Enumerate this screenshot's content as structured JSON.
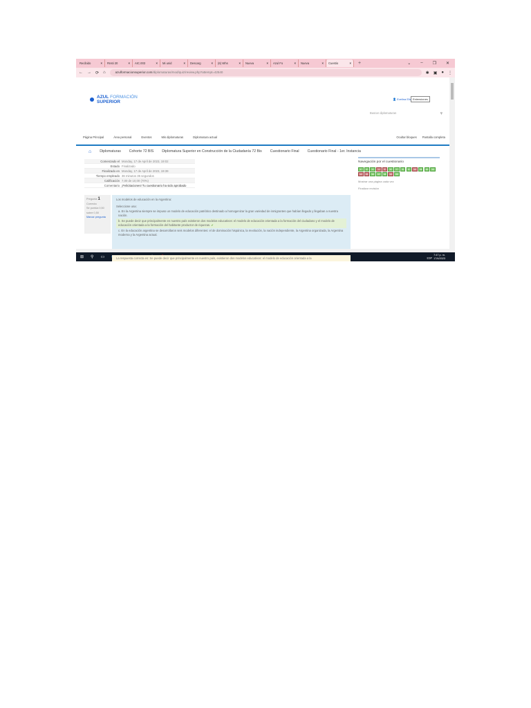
{
  "browser": {
    "tabs": [
      "Recibido",
      "Rnsti 20",
      "AIC.003",
      "Mi unid",
      "Descarg",
      "(6) Whs",
      "Nueva",
      "Azul Fo",
      "Nueva",
      "Cuestio"
    ],
    "url_domain": "azulformacionsuperior.com",
    "url_path": "/diplomaturas/mod/quiz/review.php?attempt=42540",
    "tooltip": "Extensiones"
  },
  "site": {
    "logo_line1": "AZUL",
    "logo_line1b": " FORMACIÓN",
    "logo_line2": "SUPERIOR",
    "search_placeholder": "Buscar diplomaturas",
    "user": "Evelina Elizabeth Lo",
    "menu": [
      "Página Principal",
      "Área personal",
      "Eventos",
      "Mis diplomaturas",
      "Diplomatura actual"
    ],
    "menu_right": [
      "Ocultar bloques",
      "Pantalla completa"
    ]
  },
  "breadcrumb": [
    "Diplomaturas",
    "Cohorte 72 BIS",
    "Diplomatura Superior en Construcción de la Ciudadanía 72 Bis",
    "Cuestionario Final",
    "Cuestionario Final - 1er. Instancia"
  ],
  "summary": [
    {
      "k": "Comenzado el",
      "v": "Monday, 17 de April de 2023, 19:02"
    },
    {
      "k": "Estado",
      "v": "Finalizado"
    },
    {
      "k": "Finalizado en",
      "v": "Monday, 17 de April de 2023, 19:39"
    },
    {
      "k": "Tiempo empleado",
      "v": "36 minutos 35 segundos"
    },
    {
      "k": "Calificación",
      "v": "7,00 de 10,00 (70%)"
    },
    {
      "k": "Comentario",
      "v": "¡Felicitaciones! Tu cuestionario ha sido aprobado"
    }
  ],
  "question": {
    "label": "Pregunta",
    "number": "1",
    "state": "Correcta",
    "points": "Se puntúa 0,50 sobre 0,50",
    "flag": "Marcar pregunta",
    "text": "Los modelos de educación en la Argentina:",
    "prompt": "Seleccione una:",
    "options": [
      "a. En la Argentina siempre se impuso un modelo de educación patriótico destinado a homogenizar la gran variedad de inmigrantes que habían llegado y llegaban a nuestra nación.",
      "b. Se puede decir que principalmente en nuestro país existieron dos modelos educativos: el modelo de educación orientada a la formación del ciudadano y el modelo de educación orientada a la formación del habitante productor de riquezas.",
      "c. En la educación argentina se desarrollaron seis modelos diferentes: el de dominación hispánica, la revolución, la nación independiente, la Argentina organizada, la Argentina moderna y la Argentina actual."
    ],
    "correct_answer": "La respuesta correcta es: Se puede decir que principalmente en nuestro país, existieron dos modelos educativos: el modelo de educación orientada a la"
  },
  "quiz_nav": {
    "title": "Navegación por el cuestionario",
    "buttons": [
      {
        "n": "1",
        "s": "c"
      },
      {
        "n": "2",
        "s": "c"
      },
      {
        "n": "3",
        "s": "c"
      },
      {
        "n": "4",
        "s": "w"
      },
      {
        "n": "5",
        "s": "w"
      },
      {
        "n": "6",
        "s": "c"
      },
      {
        "n": "7",
        "s": "c"
      },
      {
        "n": "8",
        "s": "c"
      },
      {
        "n": "9",
        "s": "c"
      },
      {
        "n": "10",
        "s": "w"
      },
      {
        "n": "11",
        "s": "c"
      },
      {
        "n": "12",
        "s": "c"
      },
      {
        "n": "13",
        "s": "c"
      },
      {
        "n": "14",
        "s": "w"
      },
      {
        "n": "15",
        "s": "w"
      },
      {
        "n": "16",
        "s": "c"
      },
      {
        "n": "17",
        "s": "c"
      },
      {
        "n": "18",
        "s": "c"
      },
      {
        "n": "19",
        "s": "w"
      },
      {
        "n": "20",
        "s": "c"
      }
    ],
    "show_one": "Mostrar una página cada vez",
    "finish": "Finalizar revisión"
  },
  "taskbar": {
    "time": "7:47 p. m.",
    "date": "17/4/2023",
    "lang": "ESP"
  }
}
